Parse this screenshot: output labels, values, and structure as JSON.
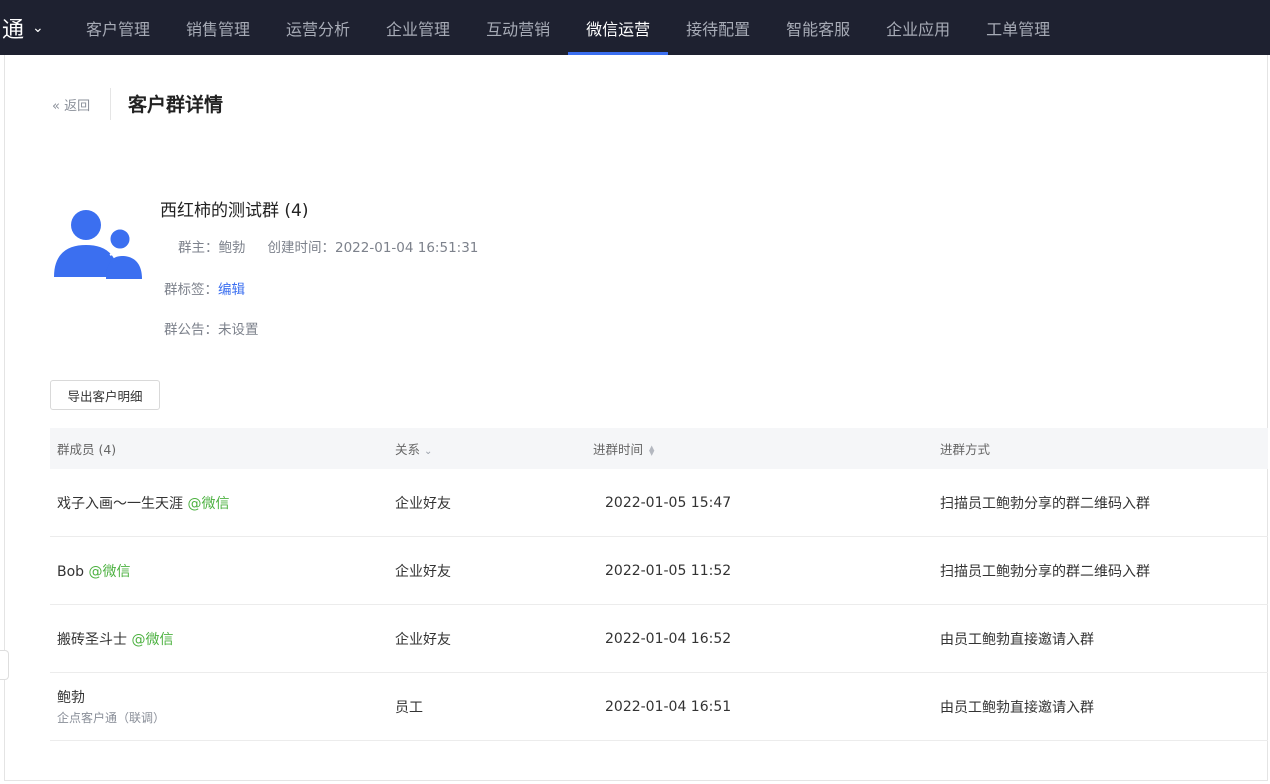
{
  "nav": {
    "brand": "通",
    "items": [
      {
        "label": "客户管理"
      },
      {
        "label": "销售管理"
      },
      {
        "label": "运营分析"
      },
      {
        "label": "企业管理"
      },
      {
        "label": "互动营销"
      },
      {
        "label": "微信运营",
        "active": true
      },
      {
        "label": "接待配置"
      },
      {
        "label": "智能客服"
      },
      {
        "label": "企业应用"
      },
      {
        "label": "工单管理"
      }
    ],
    "active_color": "#3b6ff0"
  },
  "header": {
    "back_label": "« 返回",
    "title": "客户群详情"
  },
  "group": {
    "name": "西红柿的测试群 (4)",
    "owner_label": "群主：",
    "owner": "鲍勃",
    "created_label": "创建时间：",
    "created": "2022-01-04 16:51:31",
    "tags_label": "群标签：",
    "tags_edit": "编辑",
    "notice_label": "群公告：",
    "notice": "未设置"
  },
  "export_button": "导出客户明细",
  "table": {
    "headers": {
      "member": "群成员 (4)",
      "relation": "关系",
      "join_time": "进群时间",
      "join_way": "进群方式"
    },
    "rows": [
      {
        "name": "戏子入画～一生天涯",
        "tag": "@微信",
        "sub": "",
        "relation": "企业好友",
        "time": "2022-01-05 15:47",
        "way": "扫描员工鲍勃分享的群二维码入群"
      },
      {
        "name": "Bob",
        "tag": "@微信",
        "sub": "",
        "relation": "企业好友",
        "time": "2022-01-05 11:52",
        "way": "扫描员工鲍勃分享的群二维码入群"
      },
      {
        "name": "搬砖圣斗士",
        "tag": "@微信",
        "sub": "",
        "relation": "企业好友",
        "time": "2022-01-04 16:52",
        "way": "由员工鲍勃直接邀请入群"
      },
      {
        "name": "鲍勃",
        "tag": "",
        "sub": "企点客户通（联调）",
        "relation": "员工",
        "time": "2022-01-04 16:51",
        "way": "由员工鲍勃直接邀请入群"
      }
    ]
  },
  "colors": {
    "nav_bg": "#1e2130",
    "link": "#3b6ff0",
    "wechat_tag": "#4cb140",
    "avatar": "#3b6ff0"
  }
}
